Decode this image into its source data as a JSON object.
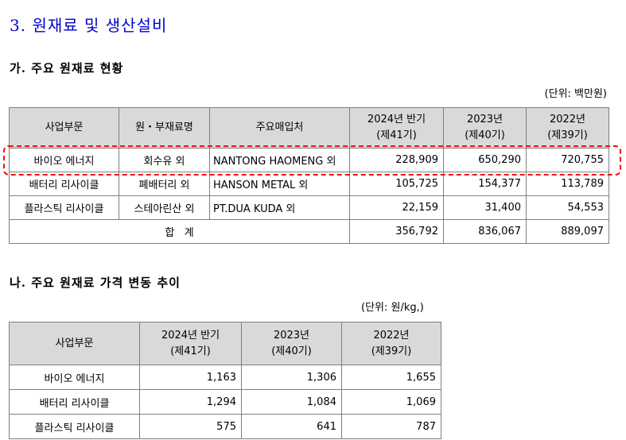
{
  "section_title": "3. 원재료 및 생산설비",
  "raw_materials": {
    "title": "가. 주요 원재료 현황",
    "unit": "(단위: 백만원)",
    "headers": [
      "사업부문",
      "원・부재료명",
      "주요매입처",
      "2024년 반기\n(제41기)",
      "2023년\n(제40기)",
      "2022년\n(제39기)"
    ],
    "rows": [
      [
        "바이오 에너지",
        "회수유 외",
        "NANTONG HAOMENG 외",
        "228,909",
        "650,290",
        "720,755"
      ],
      [
        "배터리 리사이클",
        "폐배터리 외",
        "HANSON METAL 외",
        "105,725",
        "154,377",
        "113,789"
      ],
      [
        "플라스틱 리사이클",
        "스테아린산 외",
        "PT.DUA KUDA 외",
        "22,159",
        "31,400",
        "54,553"
      ]
    ],
    "total": {
      "label": "합   계",
      "values": [
        "356,792",
        "836,067",
        "889,097"
      ]
    },
    "highlight_color": "#ee1111"
  },
  "price_trend": {
    "title": "나. 주요 원재료 가격 변동 추이",
    "unit": "(단위: 원/kg,)",
    "headers": [
      "사업부문",
      "2024년 반기\n(제41기)",
      "2023년\n(제40기)",
      "2022년\n(제39기)"
    ],
    "rows": [
      [
        "바이오 에너지",
        "1,163",
        "1,306",
        "1,655"
      ],
      [
        "배터리 리사이클",
        "1,294",
        "1,084",
        "1,069"
      ],
      [
        "플라스틱 리사이클",
        "575",
        "641",
        "787"
      ]
    ]
  },
  "colors": {
    "section_title": "#0000cc",
    "header_bg": "#d9d9d9",
    "border": "#7f7f7f"
  }
}
